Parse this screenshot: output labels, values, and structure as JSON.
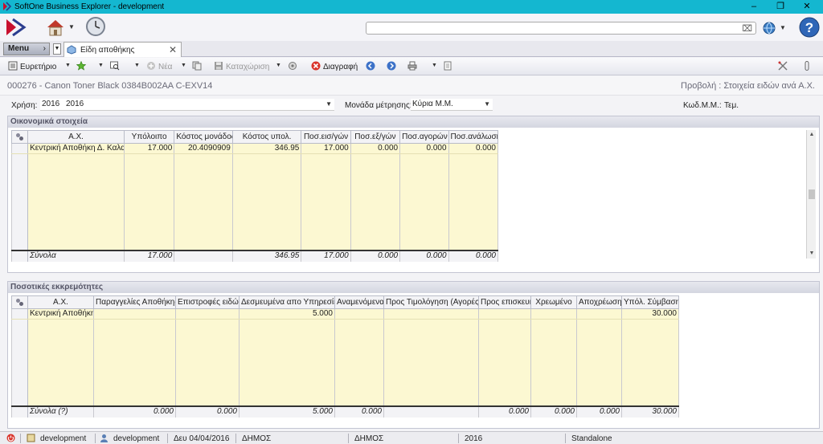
{
  "window": {
    "title": "SoftOne Business Explorer - development"
  },
  "topbar": {
    "search_placeholder": ""
  },
  "tabbar": {
    "menu_label": "Menu",
    "tab_label": "Είδη αποθήκης"
  },
  "toolbar": {
    "index_label": "Ευρετήριο",
    "new_label": "Νέα",
    "save_label": "Καταχώριση",
    "delete_label": "Διαγραφή"
  },
  "record": {
    "title": "000276 - Canon Toner Black 0384B002AA C-EXV14",
    "view_title": "Προβολή : Στοιχεία ειδών ανά Α.Χ."
  },
  "fields": {
    "year_label": "Χρήση:",
    "year_code": "2016",
    "year_value": "2016",
    "unit_label": "Μονάδα μέτρησης:",
    "unit_value": "Κύρια Μ.Μ.",
    "unit_code_label": "Κωδ.Μ.Μ.:",
    "unit_code_value": "Τεμ."
  },
  "financial": {
    "title": "Οικονομικά στοιχεία",
    "columns": [
      "Α.Χ.",
      "Υπόλοιπο",
      "Κόστος μονάδος",
      "Κόστος υπολ.",
      "Ποσ.εισ/γών",
      "Ποσ.εξ/γών",
      "Ποσ.αγορών",
      "Ποσ.ανάλωσης"
    ],
    "rows": [
      [
        "Κεντρική Αποθήκη Δ. Καλαμ",
        "17.000",
        "20.4090909",
        "346.95",
        "17.000",
        "0.000",
        "0.000",
        "0.000"
      ]
    ],
    "totals": [
      "Σύνολα",
      "17.000",
      "",
      "346.95",
      "17.000",
      "0.000",
      "0.000",
      "0.000"
    ]
  },
  "pending": {
    "title": "Ποσοτικές εκκρεμότητες",
    "columns": [
      "Α.Χ.",
      "Παραγγελίες Αποθήκης",
      "Επιστροφές ειδών",
      "Δεσμευμένα απο Υπηρεσίες",
      "Αναμενόμενα",
      "Προς Τιμολόγηση (Αγορές)",
      "Προς επισκευή",
      "Χρεωμένο",
      "Αποχρέωση",
      "Υπόλ. Σύμβασης"
    ],
    "rows": [
      [
        "Κεντρική Αποθήκη ...",
        "",
        "",
        "5.000",
        "",
        "",
        "",
        "",
        "",
        "30.000"
      ]
    ],
    "totals": [
      "Σύνολα (?)",
      "0.000",
      "0.000",
      "5.000",
      "0.000",
      "",
      "0.000",
      "0.000",
      "0.000",
      "30.000"
    ]
  },
  "status": {
    "company": "development",
    "user": "development",
    "date": "Δευ 04/04/2016",
    "branch": "ΔΗΜΟΣ",
    "branch2": "ΔΗΜΟΣ",
    "year": "2016",
    "mode": "Standalone"
  },
  "colors": {
    "titlebar": "#14b7d0",
    "grid_row": "#fcf8d2",
    "delete_icon": "#d9342b",
    "logo": "#c8102e"
  }
}
